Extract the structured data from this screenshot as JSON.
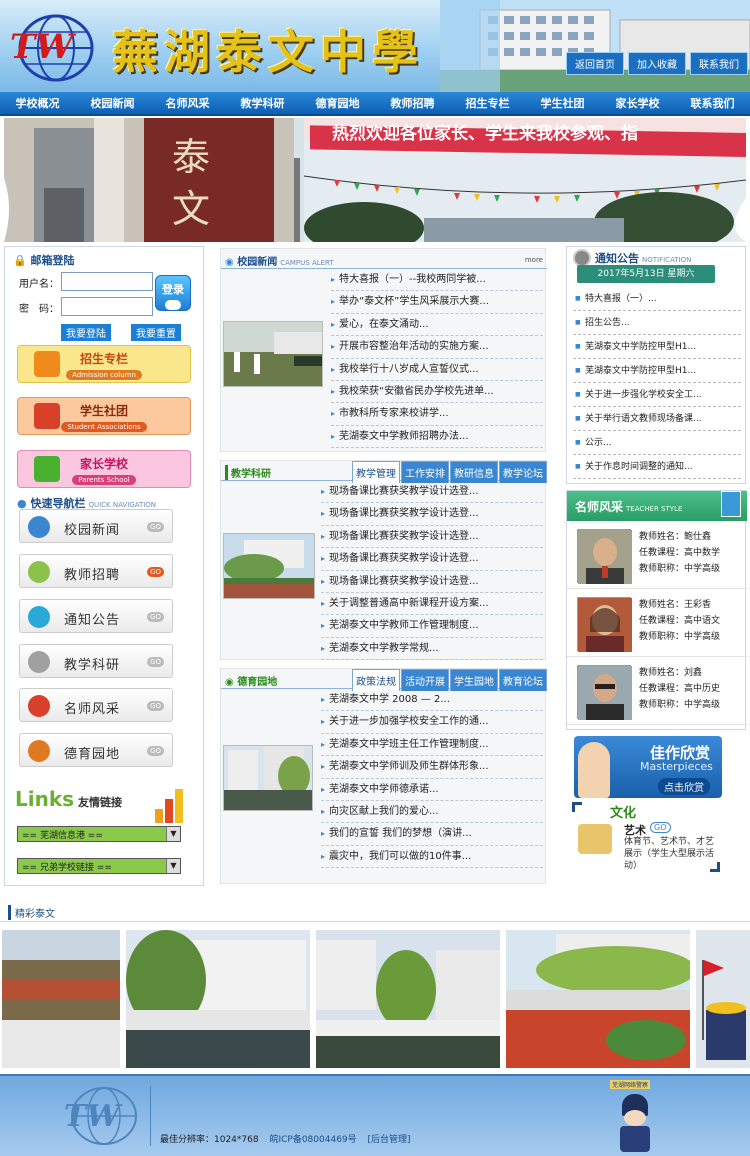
{
  "header": {
    "school_name": "蕪湖泰文中學",
    "logo_text": "TW",
    "links": [
      "返回首页",
      "加入收藏",
      "联系我们"
    ]
  },
  "nav": [
    "学校概况",
    "校园新闻",
    "名师风采",
    "教学科研",
    "德育园地",
    "教师招聘",
    "招生专栏",
    "学生社团",
    "家长学校",
    "联系我们"
  ],
  "banner": {
    "slogan": "热烈欢迎各位家长、学生来我校参观、指"
  },
  "login": {
    "title": "邮箱登陆",
    "user_label": "用户名：",
    "pass_label": "密　码：",
    "login_btn": "登录",
    "register_btn": "我要登陆",
    "reset_btn": "我要重置"
  },
  "features": [
    {
      "title": "招生专栏",
      "sub": "Admission column",
      "bg": "#fbe78b",
      "subbg": "#e07a20",
      "icon": "#f08a1a"
    },
    {
      "title": "学生社团",
      "sub": "Student Associations",
      "bg": "#fbc99d",
      "subbg": "#e05a20",
      "icon": "#d8402a"
    },
    {
      "title": "家长学校",
      "sub": "Parents School",
      "bg": "#fbc7e0",
      "subbg": "#d8407a",
      "icon": "#4ab030"
    }
  ],
  "quicknav": {
    "title": "快速导航栏",
    "sub": "QUICK NAVIGATION",
    "items": [
      {
        "label": "校园新闻",
        "go": "GO",
        "icon": "#3a86d0",
        "hot": false
      },
      {
        "label": "教师招聘",
        "go": "GO",
        "icon": "#8bc34a",
        "hot": true
      },
      {
        "label": "通知公告",
        "go": "GO",
        "icon": "#2aa8d8",
        "hot": false
      },
      {
        "label": "教学科研",
        "go": "GO",
        "icon": "#a0a0a0",
        "hot": false
      },
      {
        "label": "名师风采",
        "go": "GO",
        "icon": "#d8402a",
        "hot": false
      },
      {
        "label": "德育园地",
        "go": "GO",
        "icon": "#e07a20",
        "hot": false
      }
    ]
  },
  "links": {
    "title": "Links",
    "title_cn": "友情链接",
    "select1": "== 芜湖信息港 ==",
    "select2": "== 兄弟学校链接 =="
  },
  "news": {
    "title": "校园新闻",
    "sub": "CAMPUS ALERT",
    "more": "more",
    "items": [
      "特大喜报（一）--我校两同学被...",
      "举办“泰文杯”学生风采展示大赛...",
      "爱心，在泰文涌动...",
      "开展市容整治年活动的实施方案...",
      "我校举行十八岁成人宣誓仪式...",
      "我校荣获“安徽省民办学校先进单...",
      "市教科所专家来校讲学...",
      "芜湖泰文中学教师招聘办法..."
    ]
  },
  "research": {
    "title": "教学科研",
    "tabs": [
      "教学管理",
      "工作安排",
      "教研信息",
      "教学论坛"
    ],
    "items": [
      "现场备课比赛获奖教学设计选登...",
      "现场备课比赛获奖教学设计选登...",
      "现场备课比赛获奖教学设计选登...",
      "现场备课比赛获奖教学设计选登...",
      "现场备课比赛获奖教学设计选登...",
      "关于调整普通高中新课程开设方案...",
      "芜湖泰文中学教师工作管理制度...",
      "芜湖泰文中学教学常规..."
    ]
  },
  "moral": {
    "title": "德育园地",
    "tabs": [
      "政策法规",
      "活动开展",
      "学生园地",
      "教育论坛"
    ],
    "items": [
      "芜湖泰文中学 2008 — 2...",
      "关于进一步加强学校安全工作的通...",
      "芜湖泰文中学班主任工作管理制度...",
      "芜湖泰文中学师训及师生群体形象...",
      "芜湖泰文中学师德承诺...",
      "向灾区献上我们的爱心...",
      "我们的宣誓 我们的梦想（演讲...",
      "震灾中，我们可以做的10件事..."
    ]
  },
  "notice": {
    "title": "通知公告",
    "sub": "NOTIFICATION",
    "date": "2017年5月13日 星期六",
    "items": [
      "特大喜报（一）...",
      "招生公告...",
      "芜湖泰文中学防控甲型H1...",
      "芜湖泰文中学防控甲型H1...",
      "关于进一步强化学校安全工...",
      "关于举行语文教师现场备课...",
      "公示...",
      "关于作息时间调整的通知..."
    ]
  },
  "teachers": {
    "title": "名师风采",
    "sub": "TEACHER STYLE",
    "list": [
      {
        "name": "教师姓名：鲍仕鑫",
        "subject": "任教课程：高中数学",
        "rank": "教师职称：中学高级"
      },
      {
        "name": "教师姓名：王彩香",
        "subject": "任教课程：高中语文",
        "rank": "教师职称：中学高级"
      },
      {
        "name": "教师姓名：刘鑫",
        "subject": "任教课程：高中历史",
        "rank": "教师职称：中学高级"
      }
    ]
  },
  "masterpieces": {
    "cn": "佳作欣赏",
    "en": "Masterpieces",
    "btn": "点击欣赏"
  },
  "culture": {
    "title": "文化",
    "sub_title": "艺术",
    "go": "GO",
    "desc": "体育节、艺术节、才艺展示（学生大型展示活动）"
  },
  "photos": {
    "title": "精彩泰文"
  },
  "footer": {
    "resolution": "最佳分辨率：1024*768",
    "icp": "皖ICP备08004469号",
    "admin": "[后台管理]",
    "police": "芜湖网络警察"
  }
}
